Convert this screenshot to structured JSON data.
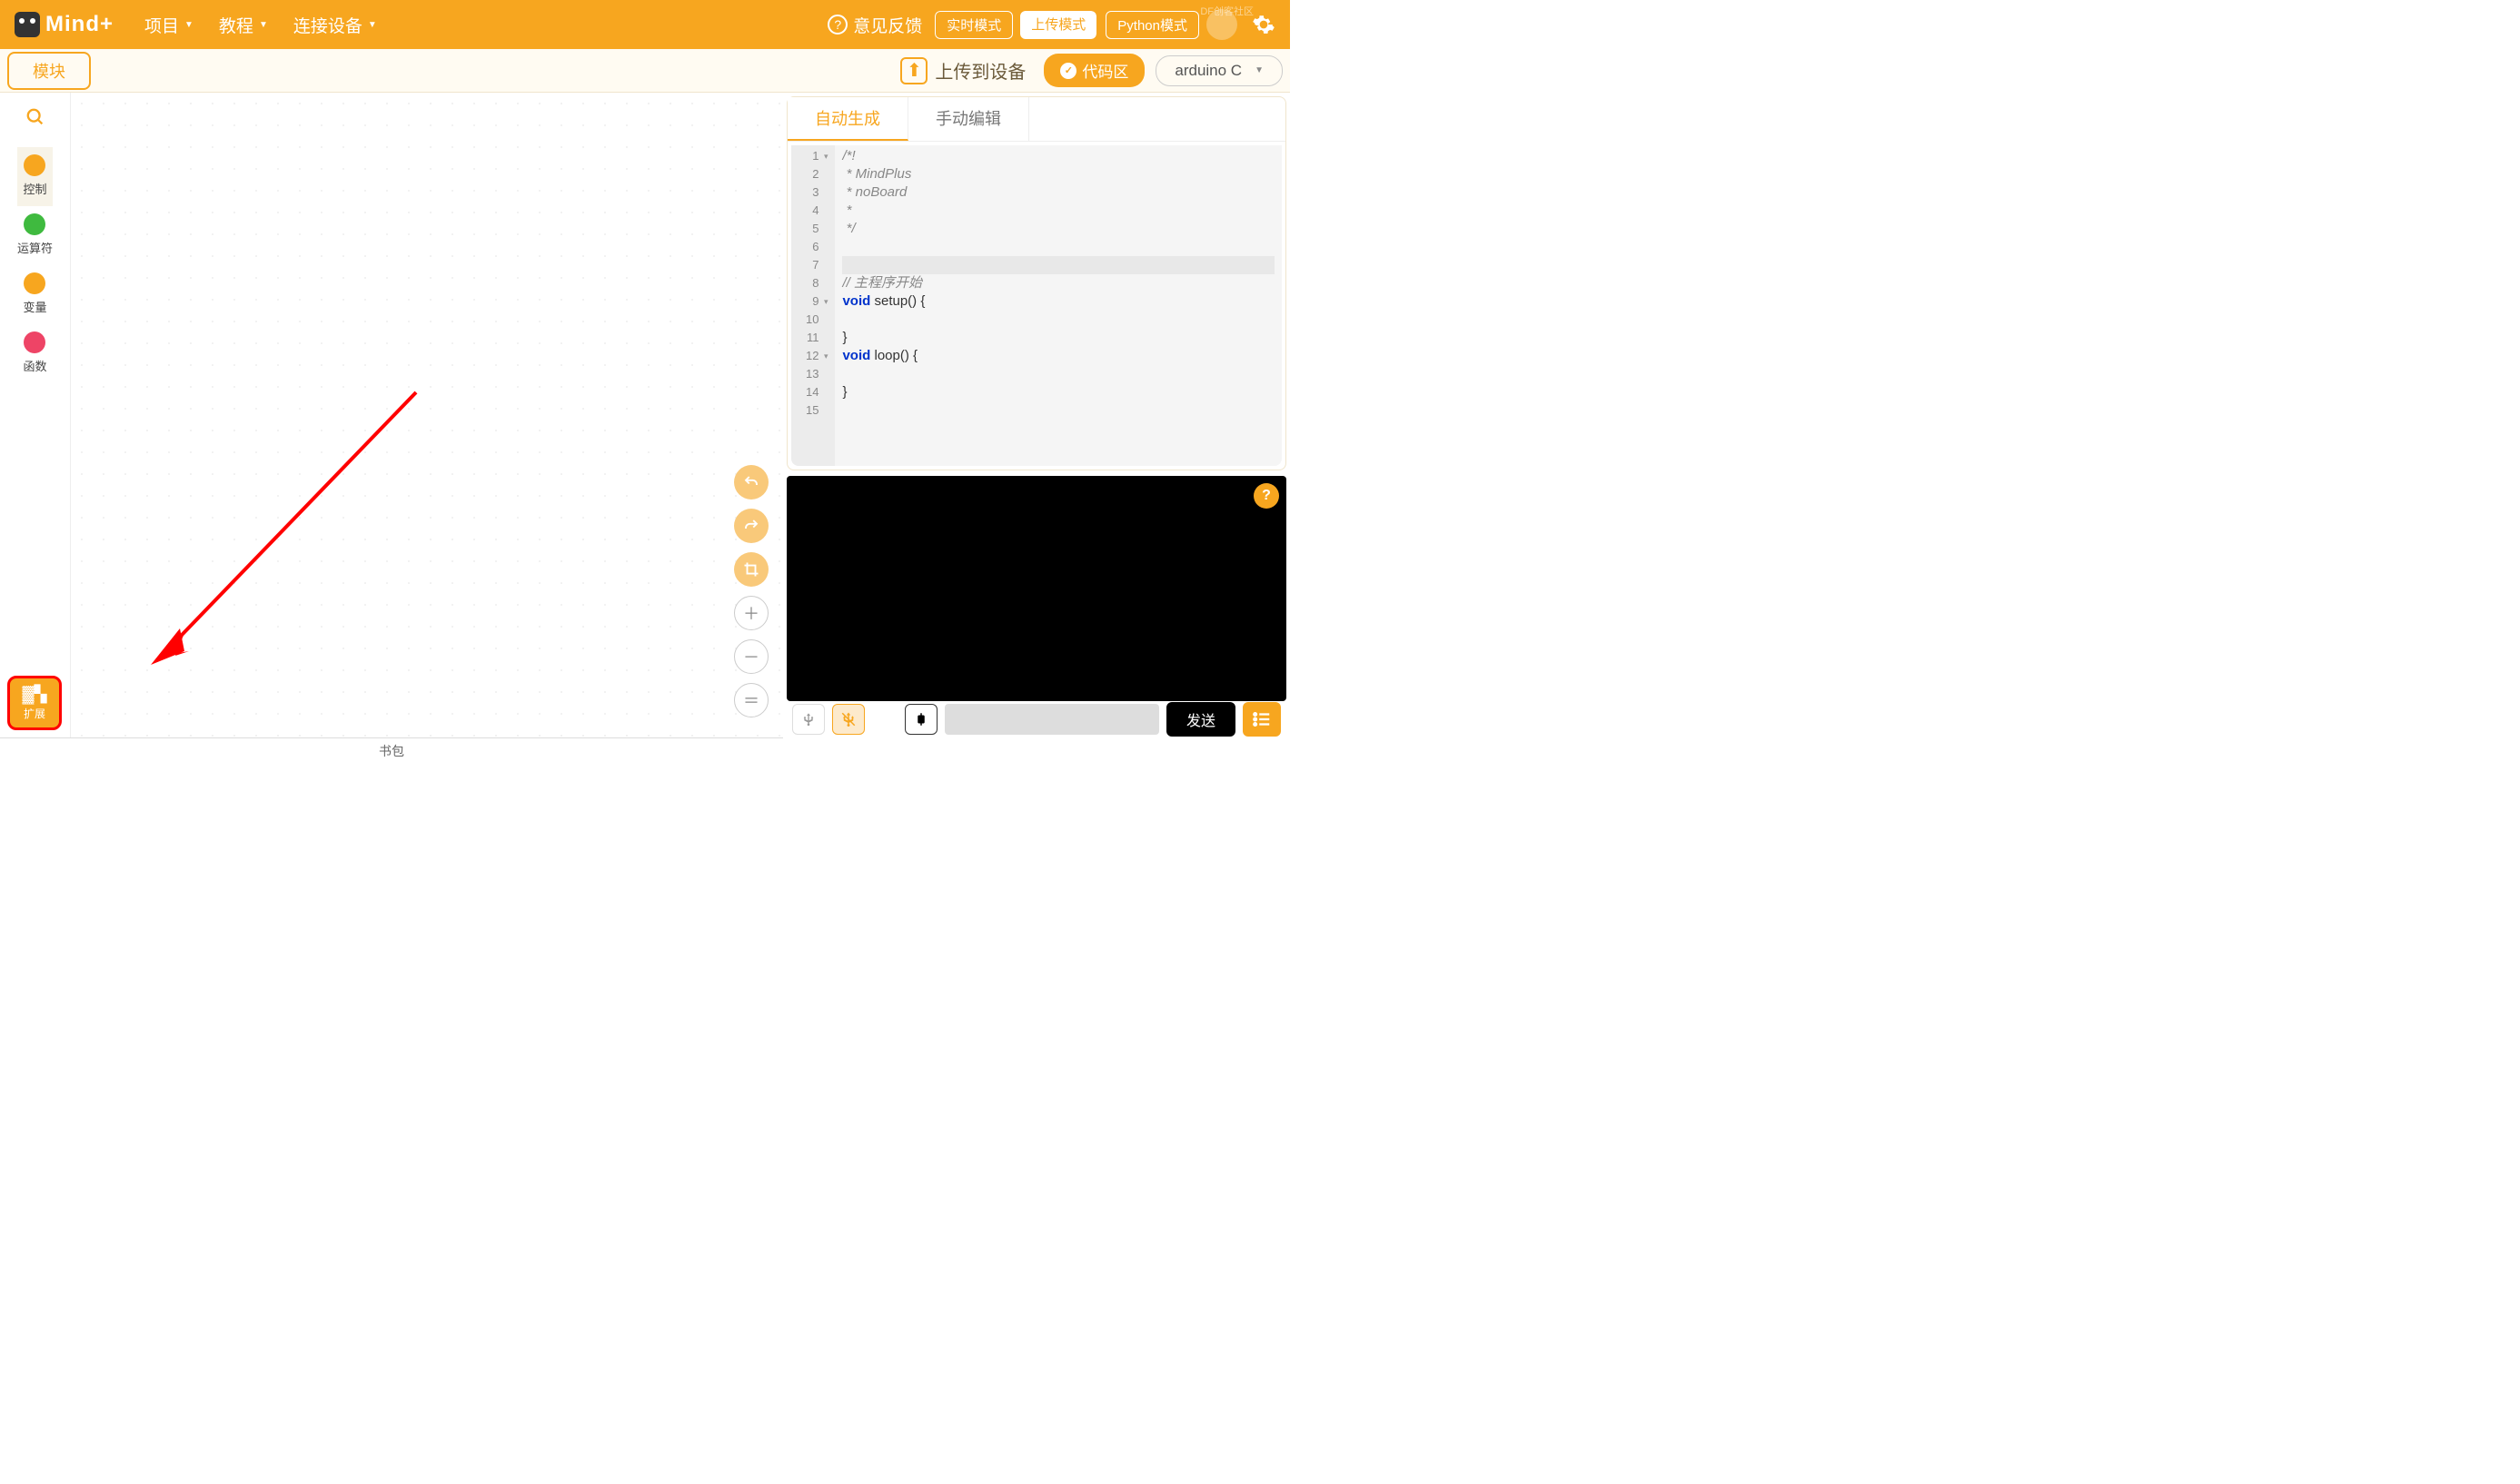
{
  "header": {
    "logo_text": "Mind+",
    "menus": [
      {
        "label": "项目"
      },
      {
        "label": "教程"
      },
      {
        "label": "连接设备"
      }
    ],
    "feedback": "意见反馈",
    "modes": {
      "realtime": "实时模式",
      "upload": "上传模式",
      "python": "Python模式"
    },
    "df_community": "DF创客社区"
  },
  "toolbar": {
    "block_tab": "模块",
    "upload_device": "上传到设备",
    "code_area": "代码区",
    "language": "arduino C"
  },
  "categories": [
    {
      "label": "控制",
      "color": "#f7a61f",
      "active": true
    },
    {
      "label": "运算符",
      "color": "#3fba3f",
      "active": false
    },
    {
      "label": "变量",
      "color": "#f7a61f",
      "active": false
    },
    {
      "label": "函数",
      "color": "#ee4466",
      "active": false
    }
  ],
  "extension": {
    "label": "扩展"
  },
  "code_tabs": {
    "auto": "自动生成",
    "manual": "手动编辑"
  },
  "code_lines": [
    {
      "n": 1,
      "fold": "▾",
      "html": "<span class=\"cmt\">/*!</span>"
    },
    {
      "n": 2,
      "fold": "",
      "html": "<span class=\"cmt\"> * MindPlus</span>"
    },
    {
      "n": 3,
      "fold": "",
      "html": "<span class=\"cmt\"> * noBoard</span>"
    },
    {
      "n": 4,
      "fold": "",
      "html": "<span class=\"cmt\"> *</span>"
    },
    {
      "n": 5,
      "fold": "",
      "html": "<span class=\"cmt\"> */</span>"
    },
    {
      "n": 6,
      "fold": "",
      "html": ""
    },
    {
      "n": 7,
      "fold": "",
      "html": "<span class=\"cur-line\"> </span>"
    },
    {
      "n": 8,
      "fold": "",
      "html": "<span class=\"cmt\">// 主程序开始</span>"
    },
    {
      "n": 9,
      "fold": "▾",
      "html": "<span class=\"kw\">void</span> setup() {"
    },
    {
      "n": 10,
      "fold": "",
      "html": ""
    },
    {
      "n": 11,
      "fold": "",
      "html": "}"
    },
    {
      "n": 12,
      "fold": "▾",
      "html": "<span class=\"kw\">void</span> loop() {"
    },
    {
      "n": 13,
      "fold": "",
      "html": ""
    },
    {
      "n": 14,
      "fold": "",
      "html": "}"
    },
    {
      "n": 15,
      "fold": "",
      "html": ""
    }
  ],
  "bottom": {
    "send": "发送"
  },
  "footer": {
    "backpack": "书包"
  }
}
